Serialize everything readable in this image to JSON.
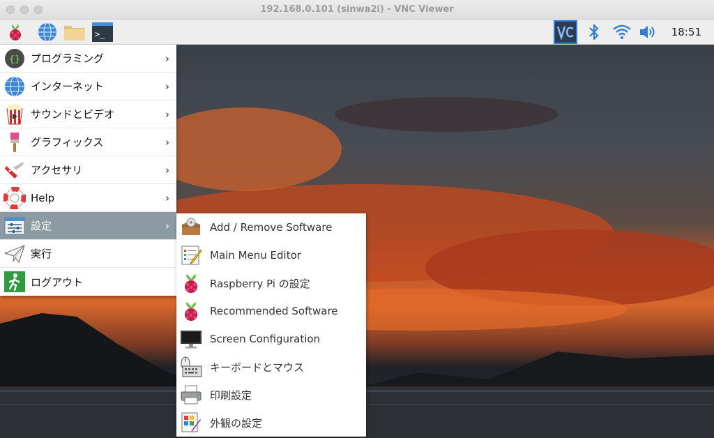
{
  "window": {
    "title": "192.168.0.101 (sinwa2i) - VNC Viewer"
  },
  "taskbar": {
    "clock": "18:51",
    "launchers": [
      "raspberry-menu",
      "web-browser",
      "file-manager",
      "terminal"
    ],
    "tray": [
      "vnc-server",
      "bluetooth",
      "wifi",
      "volume"
    ],
    "terminal_glyph": ">_"
  },
  "menu": {
    "items": [
      {
        "label": "プログラミング",
        "icon": "programming-icon",
        "has_submenu": true
      },
      {
        "label": "インターネット",
        "icon": "globe-icon",
        "has_submenu": true
      },
      {
        "label": "サウンドとビデオ",
        "icon": "sound-video-icon",
        "has_submenu": true
      },
      {
        "label": "グラフィックス",
        "icon": "paintbrush-icon",
        "has_submenu": true
      },
      {
        "label": "アクセサリ",
        "icon": "pocketknife-icon",
        "has_submenu": true
      },
      {
        "label": "Help",
        "icon": "lifebuoy-icon",
        "has_submenu": true
      },
      {
        "label": "設定",
        "icon": "settings-sliders-icon",
        "has_submenu": true,
        "selected": true
      },
      {
        "label": "実行",
        "icon": "paper-plane-icon",
        "has_submenu": false
      },
      {
        "label": "ログアウト",
        "icon": "exit-icon",
        "has_submenu": false
      }
    ]
  },
  "submenu": {
    "items": [
      {
        "label": "Add / Remove Software",
        "icon": "package-icon"
      },
      {
        "label": "Main Menu Editor",
        "icon": "menu-editor-icon"
      },
      {
        "label": "Raspberry Pi の設定",
        "icon": "raspberry-icon"
      },
      {
        "label": "Recommended Software",
        "icon": "raspberry-icon"
      },
      {
        "label": "Screen Configuration",
        "icon": "monitor-icon"
      },
      {
        "label": "キーボードとマウス",
        "icon": "keyboard-mouse-icon"
      },
      {
        "label": "印刷設定",
        "icon": "printer-icon"
      },
      {
        "label": "外観の設定",
        "icon": "appearance-icon"
      }
    ]
  },
  "colors": {
    "menu_selected_bg": "#8c9aa3",
    "raspberry": "#c51a4a",
    "leaf": "#6cc04a",
    "tray_blue": "#2f7fd8"
  }
}
